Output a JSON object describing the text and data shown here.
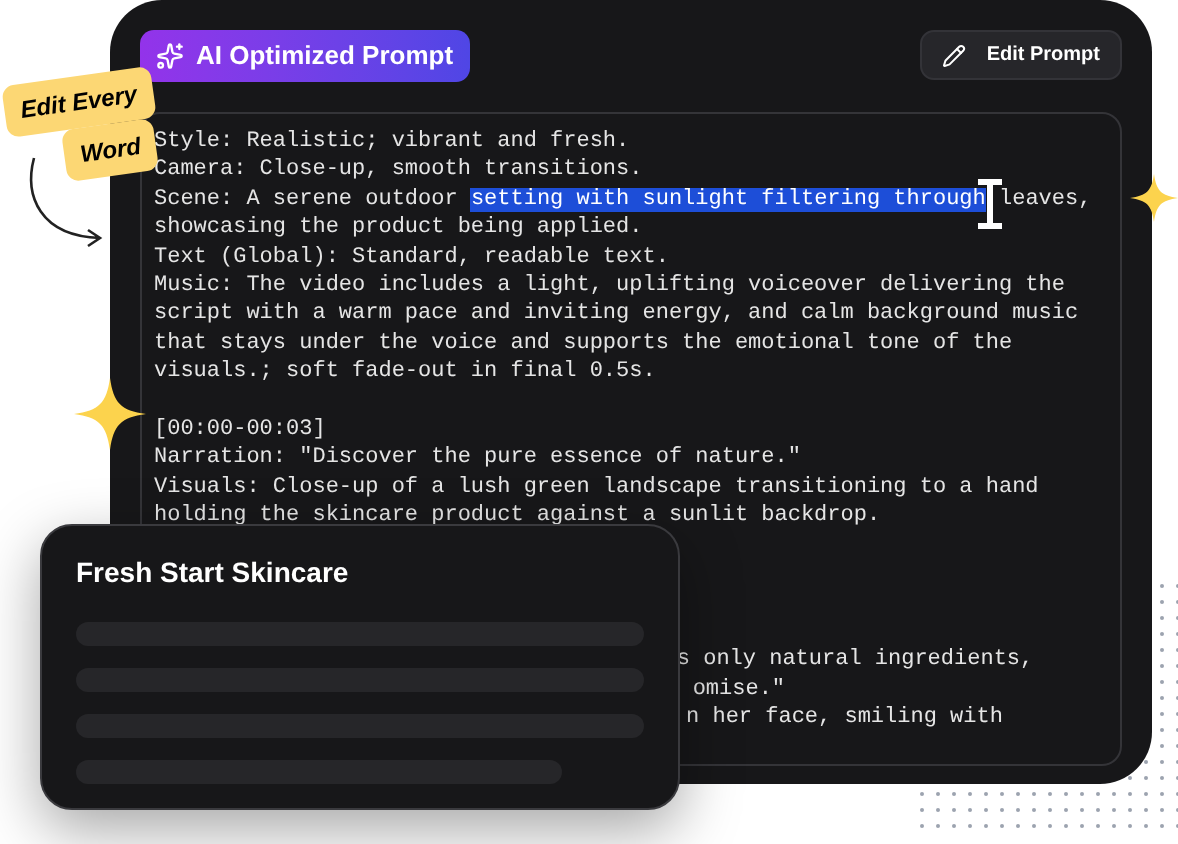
{
  "badge": {
    "label": "AI Optimized Prompt"
  },
  "edit_button": {
    "label": "Edit Prompt"
  },
  "sticker": {
    "lines": [
      "Edit Every",
      "Word"
    ]
  },
  "prompt_lines": [
    {
      "parts": [
        {
          "text": "Style: Realistic; vibrant and fresh.",
          "selected": false
        }
      ]
    },
    {
      "parts": [
        {
          "text": "Camera: Close-up, smooth transitions.",
          "selected": false
        }
      ]
    },
    {
      "parts": [
        {
          "text": "Scene: A serene outdoor ",
          "selected": false
        },
        {
          "text": "setting with sunlight filtering through",
          "selected": true
        },
        {
          "text": " leaves,",
          "selected": false
        }
      ]
    },
    {
      "parts": [
        {
          "text": "showcasing the product being applied.",
          "selected": false
        }
      ]
    },
    {
      "parts": [
        {
          "text": "Text (Global): Standard, readable text.",
          "selected": false
        }
      ]
    },
    {
      "parts": [
        {
          "text": "Music: The video includes a light, uplifting voiceover delivering the",
          "selected": false
        }
      ]
    },
    {
      "parts": [
        {
          "text": "script with a warm pace and inviting energy, and calm background music",
          "selected": false
        }
      ]
    },
    {
      "parts": [
        {
          "text": "that stays under the voice and supports the emotional tone of the",
          "selected": false
        }
      ]
    },
    {
      "parts": [
        {
          "text": "visuals.; soft fade-out in final 0.5s.",
          "selected": false
        }
      ]
    },
    {
      "kind": "blank"
    },
    {
      "parts": [
        {
          "text": "[00:00-00:03]",
          "selected": false
        }
      ]
    },
    {
      "parts": [
        {
          "text": "Narration: \"Discover the pure essence of nature.\"",
          "selected": false
        }
      ]
    },
    {
      "parts": [
        {
          "text": "Visuals: Close-up of a lush green landscape transitioning to a hand",
          "selected": false
        }
      ]
    },
    {
      "parts": [
        {
          "text": "holding the skincare product against a sunlit backdrop.",
          "selected": false
        }
      ]
    }
  ],
  "covered_lines": [
    "s only natural ingredients,",
    "omise.\"",
    "n her face, smiling with"
  ],
  "card": {
    "title": "Fresh Start Skincare"
  }
}
